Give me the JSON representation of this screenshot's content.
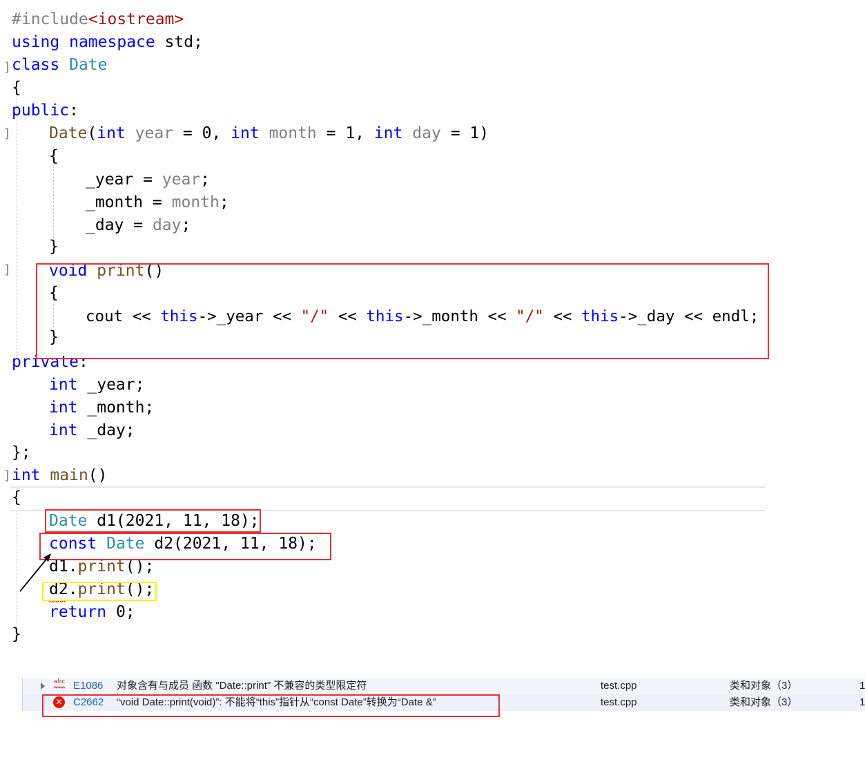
{
  "code": {
    "line1_directive": "#include",
    "line1_header": "<iostream>",
    "line2_using": "using",
    "line2_namespace": "namespace",
    "line2_std": " std;",
    "line3_class": "class",
    "line3_name": "Date",
    "line4": "{",
    "line5_public": "public",
    "line5_colon": ":",
    "line6_ctor": "Date",
    "line6_int1": "int",
    "line6_year": "year",
    "line6_eq1": " = 0, ",
    "line6_int2": "int",
    "line6_month": "month",
    "line6_eq2": " = 1, ",
    "line6_int3": "int",
    "line6_day": "day",
    "line6_eq3": " = 1)",
    "line7": "{",
    "line8_field": "_year = ",
    "line8_param": "year",
    "line9_field": "_month = ",
    "line9_param": "month",
    "line10_field": "_day = ",
    "line10_param": "day",
    "line11": "}",
    "line12_void": "void",
    "line12_fn": "print",
    "line12_parens": "()",
    "line13": "{",
    "line14_cout": "cout << ",
    "line14_this1": "this",
    "line14_year": "->_year << ",
    "line14_slash1": "\"/\"",
    "line14_op1": " << ",
    "line14_this2": "this",
    "line14_month": "->_month << ",
    "line14_slash2": "\"/\"",
    "line14_op2": " << ",
    "line14_this3": "this",
    "line14_day": "->_day << ",
    "line14_endl": "endl",
    "line14_semi": ";",
    "line15": "}",
    "line16_private": "private",
    "line16_colon": ":",
    "line17_int": "int",
    "line17_rest": " _year;",
    "line18_int": "int",
    "line18_rest": " _month;",
    "line19_int": "int",
    "line19_rest": " _day;",
    "line20": "};",
    "line21_int": "int",
    "line21_main": "main",
    "line21_parens": "()",
    "line22": "{",
    "line23_type": "Date",
    "line23_rest": " d1(2021, 11, 18);",
    "line24_const": "const",
    "line24_type": "Date",
    "line24_rest": " d2(2021, 11, 18);",
    "line25_obj": "d1.",
    "line25_fn": "print",
    "line25_rest": "();",
    "line26_obj": "d2.",
    "line26_fn": "print",
    "line26_rest": "();",
    "line27_return": "return",
    "line27_rest": " 0;",
    "line28": "}"
  },
  "error_list": {
    "rows": [
      {
        "icon": "abc-squiggle-icon",
        "code": "E1086",
        "description": "对象含有与成员 函数 \"Date::print\" 不兼容的类型限定符",
        "file": "test.cpp",
        "project": "类和对象（3）",
        "line": "1"
      },
      {
        "icon": "error-icon",
        "code": "C2662",
        "description": "“void Date::print(void)”: 不能将“this”指针从“const Date”转换为“Date &”",
        "file": "test.cpp",
        "project": "类和对象（3）",
        "line": "1"
      }
    ]
  },
  "colors": {
    "keyword": "#0000ff",
    "type": "#2b91af",
    "parameter": "#808080",
    "function": "#74531f",
    "string": "#a31515",
    "annotation_red": "#e8303a",
    "annotation_yellow": "#f5f500",
    "error_red": "#e51400"
  }
}
